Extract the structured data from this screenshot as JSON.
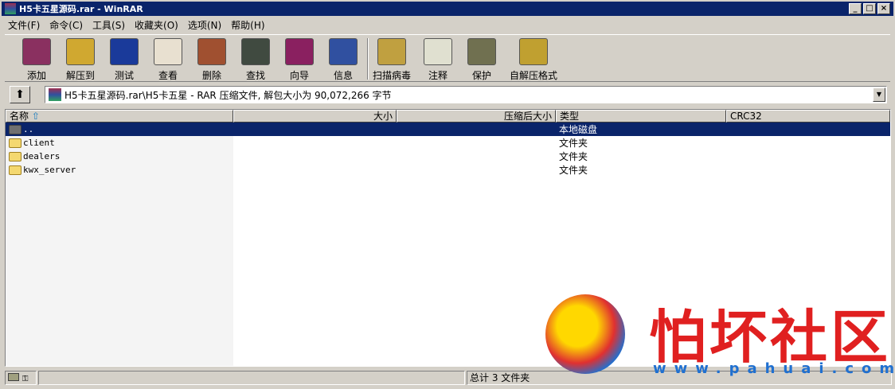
{
  "title": "H5卡五星源码.rar - WinRAR",
  "menu": [
    "文件(F)",
    "命令(C)",
    "工具(S)",
    "收藏夹(O)",
    "选项(N)",
    "帮助(H)"
  ],
  "toolbar": [
    {
      "label": "添加",
      "icon": "add-archive-icon",
      "color": "#8a3060"
    },
    {
      "label": "解压到",
      "icon": "extract-to-icon",
      "color": "#d0a830"
    },
    {
      "label": "测试",
      "icon": "test-icon",
      "color": "#1a3a9a"
    },
    {
      "label": "查看",
      "icon": "view-icon",
      "color": "#e8e0d0"
    },
    {
      "label": "删除",
      "icon": "delete-icon",
      "color": "#a05030"
    },
    {
      "label": "查找",
      "icon": "find-icon",
      "color": "#404a40"
    },
    {
      "label": "向导",
      "icon": "wizard-icon",
      "color": "#8a2060"
    },
    {
      "label": "信息",
      "icon": "info-icon",
      "color": "#3050a0"
    },
    {
      "label": "扫描病毒",
      "icon": "virus-scan-icon",
      "color": "#c0a040"
    },
    {
      "label": "注释",
      "icon": "comment-icon",
      "color": "#e0e0d0"
    },
    {
      "label": "保护",
      "icon": "protect-icon",
      "color": "#707050"
    },
    {
      "label": "自解压格式",
      "icon": "sfx-icon",
      "color": "#c0a030"
    }
  ],
  "address": "H5卡五星源码.rar\\H5卡五星 - RAR 压缩文件, 解包大小为 90,072,266 字节",
  "columns": {
    "name": "名称",
    "size": "大小",
    "packed": "压缩后大小",
    "type": "类型",
    "crc": "CRC32"
  },
  "files": [
    {
      "name": "..",
      "type": "本地磁盘"
    },
    {
      "name": "client",
      "type": "文件夹"
    },
    {
      "name": "dealers",
      "type": "文件夹"
    },
    {
      "name": "kwx_server",
      "type": "文件夹"
    }
  ],
  "status": {
    "summary": "总计 3 文件夹"
  },
  "watermark": {
    "text": "怕坏社区",
    "url": "www.pahuai.com"
  }
}
